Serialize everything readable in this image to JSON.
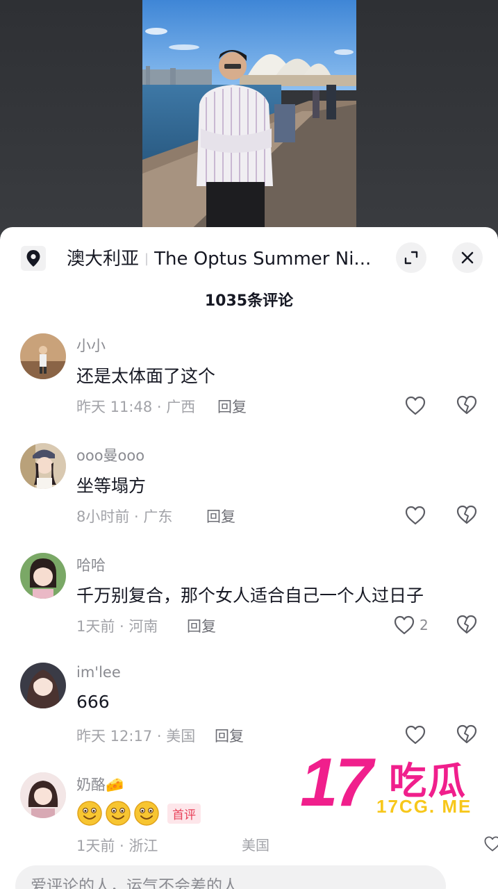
{
  "header": {
    "location_label": "澳大利亚",
    "venue_label": "The Optus Summer Ni...",
    "comment_count": "1035条评论"
  },
  "comments": [
    {
      "user": "小小",
      "text": "还是太体面了这个",
      "meta": "昨天 11:48 · 广西",
      "reply": "回复",
      "likes": ""
    },
    {
      "user": "ooo曼ooo",
      "text": "坐等塌方",
      "meta": "8小时前 · 广东",
      "reply": "回复",
      "likes": ""
    },
    {
      "user": "哈哈",
      "text": "千万别复合，那个女人适合自己一个人过日子",
      "meta": "1天前 · 河南",
      "reply": "回复",
      "likes": "2"
    },
    {
      "user": "im'lee",
      "text": "666",
      "meta": "昨天 12:17 · 美国",
      "reply": "回复",
      "likes": ""
    },
    {
      "user": "奶酪🧀",
      "text": "",
      "meta": "1天前 · 浙江",
      "reply": "",
      "likes": "",
      "badge": "首评"
    }
  ],
  "faded_region": "美国",
  "input": {
    "placeholder": "爱评论的人，运气不会差的人"
  },
  "watermark": {
    "big_number": "17",
    "big_text": "吃瓜",
    "site": "17CG. ME"
  },
  "icons": {
    "location": "location-pin-icon",
    "expand": "expand-icon",
    "close": "close-icon",
    "like": "heart-icon",
    "dislike": "broken-heart-icon"
  },
  "colors": {
    "text_primary": "#161823",
    "text_secondary": "#8a8b91",
    "watermark_pink": "#f01f8c",
    "watermark_yellow": "#f7c71b",
    "badge_red": "#e8425a"
  }
}
